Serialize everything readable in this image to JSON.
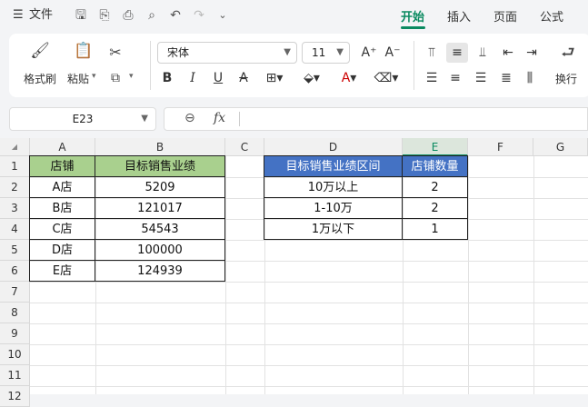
{
  "topbar": {
    "menu_label": "文件",
    "tabs": [
      {
        "label": "开始",
        "active": true
      },
      {
        "label": "插入",
        "active": false
      },
      {
        "label": "页面",
        "active": false
      },
      {
        "label": "公式",
        "active": false
      }
    ]
  },
  "ribbon": {
    "format_painter": "格式刷",
    "paste": "粘贴",
    "font_name": "宋体",
    "font_size": "11",
    "wrap": "换行"
  },
  "formula_bar": {
    "cell_ref": "E23",
    "fx": "fx",
    "value": ""
  },
  "columns": [
    "A",
    "B",
    "C",
    "D",
    "E",
    "F",
    "G"
  ],
  "rows": [
    "1",
    "2",
    "3",
    "4",
    "5",
    "6",
    "7",
    "8",
    "9",
    "10",
    "11",
    "12"
  ],
  "table1": {
    "headers": [
      "店铺",
      "目标销售业绩"
    ],
    "rows": [
      [
        "A店",
        "5209"
      ],
      [
        "B店",
        "121017"
      ],
      [
        "C店",
        "54543"
      ],
      [
        "D店",
        "100000"
      ],
      [
        "E店",
        "124939"
      ]
    ]
  },
  "table2": {
    "headers": [
      "目标销售业绩区间",
      "店铺数量"
    ],
    "rows": [
      [
        "10万以上",
        "2"
      ],
      [
        "1-10万",
        "2"
      ],
      [
        "1万以下",
        "1"
      ]
    ]
  },
  "colors": {
    "accent": "#0a8a60",
    "green_header": "#a9d08e",
    "blue_header": "#4472c4"
  }
}
